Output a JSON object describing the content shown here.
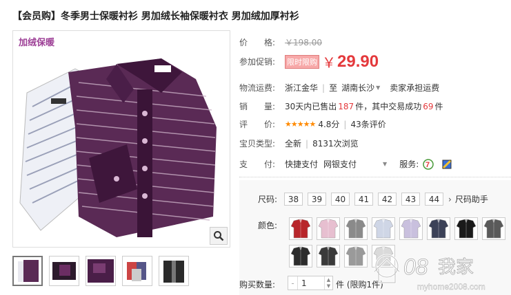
{
  "product": {
    "title": "【会员购】冬季男士保暖衬衫 男加绒长袖保暖衬衣 男加绒加厚衬衫",
    "image_tag": "加绒保暖"
  },
  "price": {
    "label": "价　　格:",
    "original": "￥198.00",
    "promo_label": "参加促销:",
    "promo_badge": "限时限购",
    "currency": "￥",
    "current": "29.90"
  },
  "shipping": {
    "label": "物流运费:",
    "from": "浙江金华",
    "to_word": "至",
    "to": "湖南长沙",
    "note": "卖家承担运费"
  },
  "sales": {
    "label": "销　　量:",
    "prefix": "30天内已售出",
    "count": "187",
    "mid": "件，其中交易成功",
    "success": "69",
    "suffix": "件"
  },
  "rating": {
    "label": "评　　价:",
    "stars": "★★★★★",
    "score": "4.8分",
    "reviews": "43条评价"
  },
  "condition": {
    "label": "宝贝类型:",
    "value": "全新",
    "views": "8131次浏览"
  },
  "payment": {
    "label": "支　　付:",
    "method1": "快捷支付",
    "method2": "网银支付",
    "service_label": "服务:"
  },
  "options": {
    "size_label": "尺码:",
    "sizes": [
      "38",
      "39",
      "40",
      "41",
      "42",
      "43",
      "44"
    ],
    "size_help": "尺码助手",
    "color_label": "颜色:",
    "colors": [
      "#b8262b",
      "#e7bfd0",
      "#8a8a8a",
      "#cfd6e6",
      "#c9c0de",
      "#3c4258",
      "#1a1a1a",
      "#5a5a5a",
      "#2c2c2c",
      "#3a3a3a",
      "#9a9a9a",
      "#dadada"
    ],
    "qty_label": "购买数量:",
    "qty_value": "1",
    "qty_unit": "件 (限购1件)"
  },
  "colors": {
    "accent": "#e4393c",
    "star": "#ff8a00",
    "shirt_purple": "#4a1e48"
  }
}
